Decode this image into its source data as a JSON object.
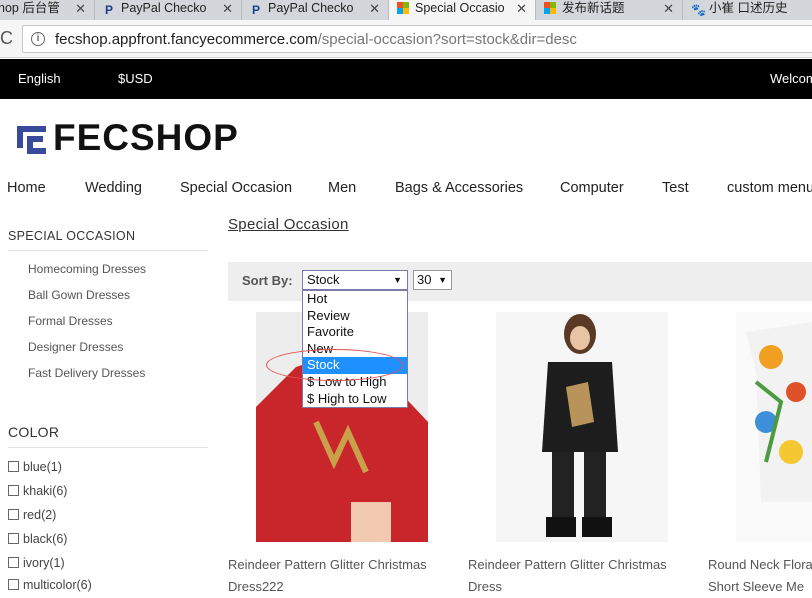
{
  "browser": {
    "tabs": [
      {
        "title": "hop 后台管",
        "icon": "fecshop-icon"
      },
      {
        "title": "PayPal Checko",
        "icon": "paypal-icon"
      },
      {
        "title": "PayPal Checko",
        "icon": "paypal-icon"
      },
      {
        "title": "Special Occasio",
        "icon": "windows-icon"
      },
      {
        "title": "发布新话题",
        "icon": "windows-icon"
      },
      {
        "title": "小崔 口述历史",
        "icon": "baidu-paw-icon"
      }
    ],
    "url_host": "fecshop.appfront.fancyecommerce.com",
    "url_path": "/special-occasion?sort=stock&dir=desc"
  },
  "topbar": {
    "language": "English",
    "currency": "$USD",
    "welcome": "Welcom"
  },
  "logo": {
    "text": "FECSHOP",
    "colors": {
      "mark": "#3a4a9a",
      "text": "#111111"
    }
  },
  "nav": [
    "Home",
    "Wedding",
    "Special Occasion",
    "Men",
    "Bags & Accessories",
    "Computer",
    "Test",
    "custom menu"
  ],
  "sidebar": {
    "category_title": "SPECIAL OCCASION",
    "categories": [
      "Homecoming Dresses",
      "Ball Gown Dresses",
      "Formal Dresses",
      "Designer Dresses",
      "Fast Delivery Dresses"
    ],
    "color_title": "COLOR",
    "colors": [
      "blue(1)",
      "khaki(6)",
      "red(2)",
      "black(6)",
      "ivory(1)",
      "multicolor(6)"
    ]
  },
  "content": {
    "title": "Special Occasion",
    "sort_label": "Sort By:",
    "sort_selected": "Stock",
    "sort_options": [
      "Hot",
      "Review",
      "Favorite",
      "New",
      "Stock",
      "$ Low to High",
      "$ High to Low"
    ],
    "per_page": "30",
    "products": [
      {
        "name_line1": "Reindeer Pattern Glitter Christmas",
        "name_line2": "Dress222"
      },
      {
        "name_line1": "Reindeer Pattern Glitter Christmas",
        "name_line2": "Dress"
      },
      {
        "name_line1": "Round Neck Flora",
        "name_line2": "Short Sleeve Me"
      }
    ]
  }
}
